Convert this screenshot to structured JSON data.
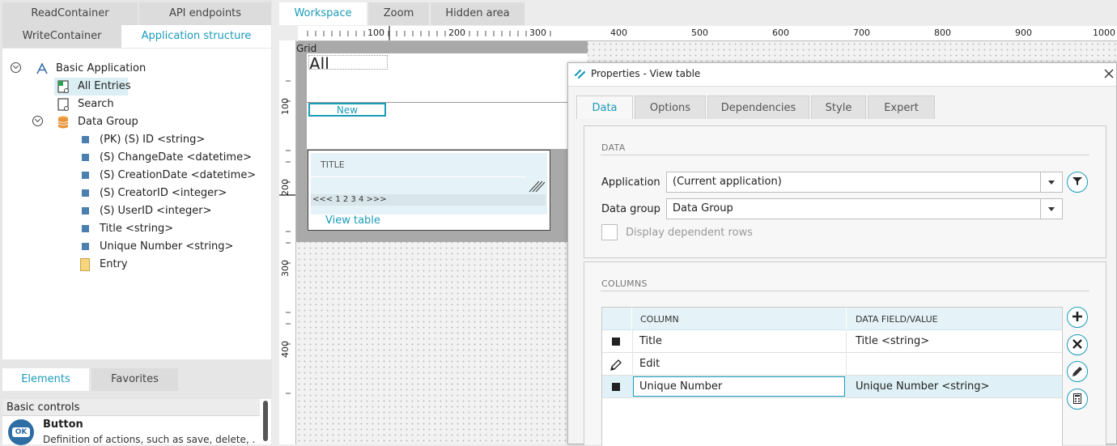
{
  "left_tabs": {
    "read_container": "ReadContainer",
    "api_endpoints": "API endpoints",
    "write_container": "WriteContainer",
    "application_structure": "Application structure"
  },
  "tree": {
    "root": "Basic Application",
    "all_entries": "All Entries",
    "search": "Search",
    "data_group": "Data Group",
    "fields": [
      "(PK) (S) ID <string>",
      "(S) ChangeDate <datetime>",
      "(S) CreationDate <datetime>",
      "(S) CreatorID <integer>",
      "(S) UserID <integer>",
      "Title <string>",
      "Unique Number <string>"
    ],
    "entry": "Entry"
  },
  "bottom_tabs": {
    "elements": "Elements",
    "favorites": "Favorites"
  },
  "elements_list": {
    "category": "Basic controls",
    "button_title": "Button",
    "button_icon_text": "OK",
    "button_desc": "Definition of actions, such as save, delete, ..."
  },
  "workspace_tabs": {
    "workspace": "Workspace",
    "zoom": "Zoom",
    "hidden_area": "Hidden area"
  },
  "ruler": {
    "top_labels": [
      "100",
      "200",
      "300",
      "400",
      "500",
      "600",
      "700",
      "800",
      "900",
      "1000"
    ],
    "left_labels": [
      "100",
      "200",
      "300",
      "400"
    ]
  },
  "canvas": {
    "grid_label": "Grid",
    "heading": "All",
    "new_button": "New",
    "table_header": "TITLE",
    "pager": "<<< 1 2 3 4 >>>",
    "view_table_label": "View table"
  },
  "dialog": {
    "title": "Properties - View table",
    "tabs": [
      "Data",
      "Options",
      "Dependencies",
      "Style",
      "Expert"
    ],
    "data_section_title": "DATA",
    "application_label": "Application",
    "application_value": "(Current application)",
    "data_group_label": "Data group",
    "data_group_value": "Data Group",
    "display_dependent_rows": "Display dependent rows",
    "columns_section_title": "COLUMNS",
    "columns_header": {
      "column": "COLUMN",
      "data_field": "DATA FIELD/VALUE"
    },
    "rows": [
      {
        "column": "Title",
        "data_field": "Title <string>"
      },
      {
        "column": "Edit",
        "data_field": ""
      },
      {
        "column": "Unique Number",
        "data_field": "Unique Number <string>"
      }
    ]
  },
  "colors": {
    "accent": "#1a9bb8",
    "field_square": "#4a7fb0",
    "selected_row": "#dff1f6",
    "tree_selection": "#dbeef3"
  }
}
